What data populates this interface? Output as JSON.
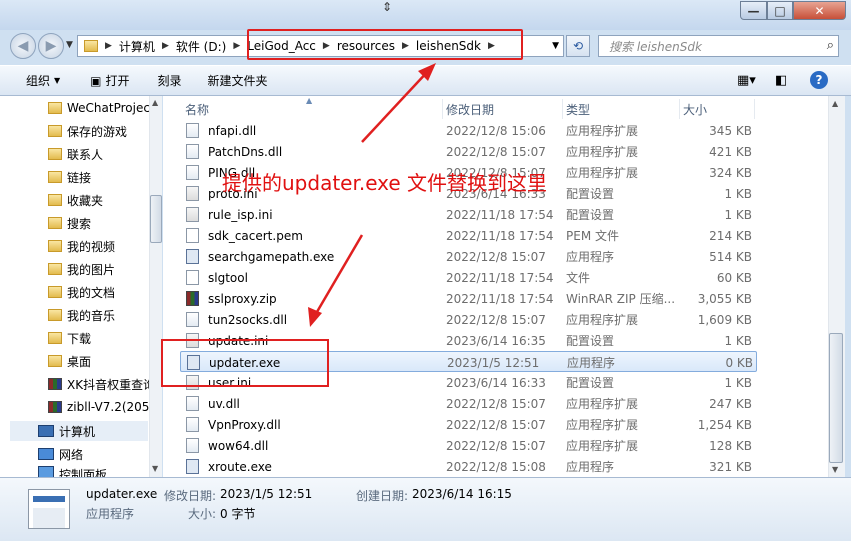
{
  "window": {
    "min": "—",
    "max": "□",
    "close": "✕"
  },
  "address": {
    "crumbs": [
      "计算机",
      "软件 (D:)",
      "LeiGod_Acc",
      "resources",
      "leishenSdk"
    ]
  },
  "search": {
    "placeholder": "搜索 leishenSdk"
  },
  "toolbar": {
    "organize": "组织",
    "open": "打开",
    "burn": "刻录",
    "new_folder": "新建文件夹"
  },
  "sidebar": {
    "items": [
      "WeChatProjec",
      "保存的游戏",
      "联系人",
      "链接",
      "收藏夹",
      "搜索",
      "我的视频",
      "我的图片",
      "我的文档",
      "我的音乐",
      "下载",
      "桌面",
      "XK抖音权重查询",
      "zibll-V7.2(205",
      "计算机",
      "网络",
      "控制面板"
    ]
  },
  "columns": {
    "name": "名称",
    "date": "修改日期",
    "type": "类型",
    "size": "大小"
  },
  "files": [
    {
      "name": "nfapi.dll",
      "date": "2022/12/8 15:06",
      "type": "应用程序扩展",
      "size": "345 KB",
      "icon": "dll"
    },
    {
      "name": "PatchDns.dll",
      "date": "2022/12/8 15:07",
      "type": "应用程序扩展",
      "size": "421 KB",
      "icon": "dll"
    },
    {
      "name": "PING.dll",
      "date": "2022/12/8 15:07",
      "type": "应用程序扩展",
      "size": "324 KB",
      "icon": "dll"
    },
    {
      "name": "proto.ini",
      "date": "2023/6/14 16:33",
      "type": "配置设置",
      "size": "1 KB",
      "icon": "ini"
    },
    {
      "name": "rule_isp.ini",
      "date": "2022/11/18 17:54",
      "type": "配置设置",
      "size": "1 KB",
      "icon": "ini"
    },
    {
      "name": "sdk_cacert.pem",
      "date": "2022/11/18 17:54",
      "type": "PEM 文件",
      "size": "214 KB",
      "icon": "doc"
    },
    {
      "name": "searchgamepath.exe",
      "date": "2022/12/8 15:07",
      "type": "应用程序",
      "size": "514 KB",
      "icon": "exe"
    },
    {
      "name": "slgtool",
      "date": "2022/11/18 17:54",
      "type": "文件",
      "size": "60 KB",
      "icon": "doc"
    },
    {
      "name": "sslproxy.zip",
      "date": "2022/11/18 17:54",
      "type": "WinRAR ZIP 压缩...",
      "size": "3,055 KB",
      "icon": "zip"
    },
    {
      "name": "tun2socks.dll",
      "date": "2022/12/8 15:07",
      "type": "应用程序扩展",
      "size": "1,609 KB",
      "icon": "dll"
    },
    {
      "name": "update.ini",
      "date": "2023/6/14 16:35",
      "type": "配置设置",
      "size": "1 KB",
      "icon": "ini"
    },
    {
      "name": "updater.exe",
      "date": "2023/1/5 12:51",
      "type": "应用程序",
      "size": "0 KB",
      "icon": "exe"
    },
    {
      "name": "user.ini",
      "date": "2023/6/14 16:33",
      "type": "配置设置",
      "size": "1 KB",
      "icon": "ini"
    },
    {
      "name": "uv.dll",
      "date": "2022/12/8 15:07",
      "type": "应用程序扩展",
      "size": "247 KB",
      "icon": "dll"
    },
    {
      "name": "VpnProxy.dll",
      "date": "2022/12/8 15:07",
      "type": "应用程序扩展",
      "size": "1,254 KB",
      "icon": "dll"
    },
    {
      "name": "wow64.dll",
      "date": "2022/12/8 15:07",
      "type": "应用程序扩展",
      "size": "128 KB",
      "icon": "dll"
    },
    {
      "name": "xroute.exe",
      "date": "2022/12/8 15:08",
      "type": "应用程序",
      "size": "321 KB",
      "icon": "exe"
    }
  ],
  "annotation": "提供的updater.exe 文件替换到这里",
  "status": {
    "name": "updater.exe",
    "modified_label": "修改日期:",
    "modified": "2023/1/5 12:51",
    "created_label": "创建日期:",
    "created": "2023/6/14 16:15",
    "type": "应用程序",
    "size_label": "大小:",
    "size": "0 字节"
  }
}
